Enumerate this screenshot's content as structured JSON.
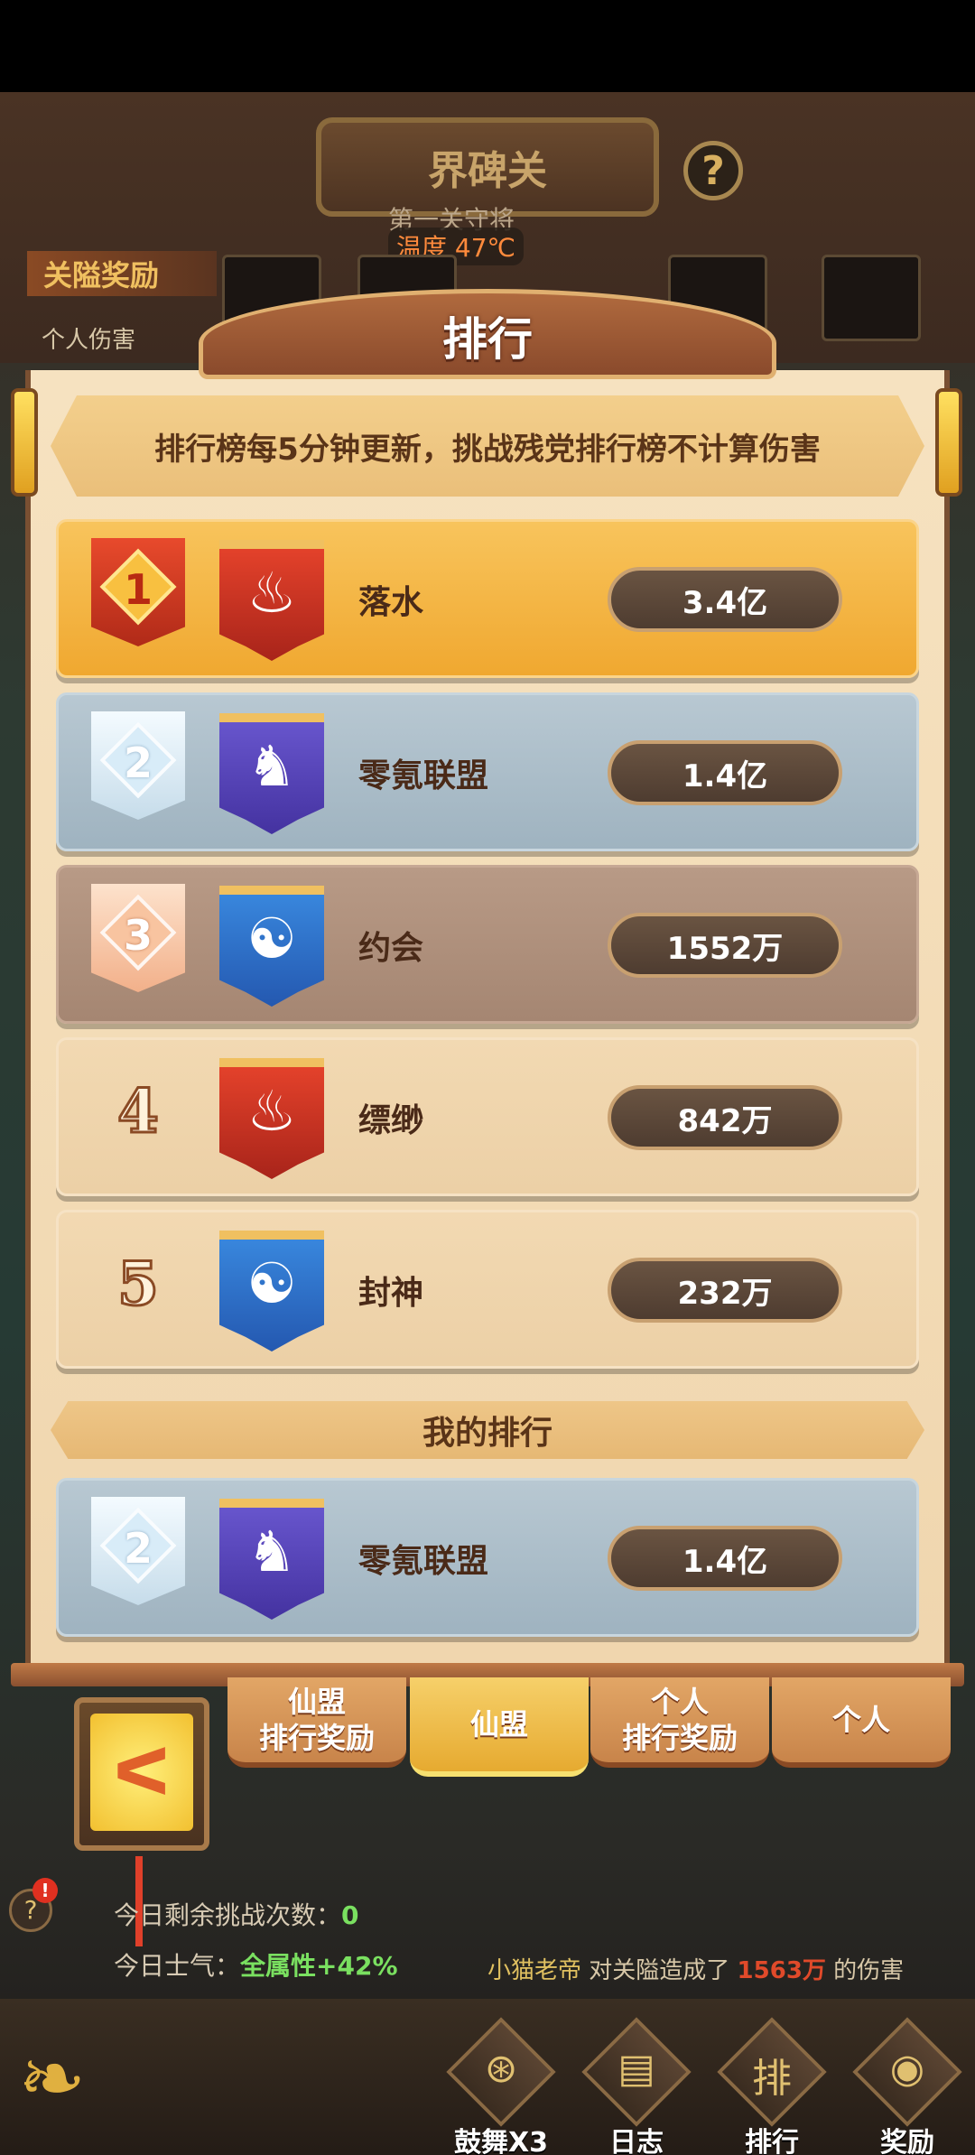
{
  "background": {
    "gate_title": "界碑关",
    "gate_subtitle": "第一关守将",
    "temperature": "温度 47℃",
    "pass_reward_label": "关隘奖励",
    "personal_damage_label": "个人伤害",
    "help_icon": "?"
  },
  "modal": {
    "title": "排行",
    "notice": "排行榜每5分钟更新，挑战残党排行榜不计算伤害",
    "my_rank_header": "我的排行"
  },
  "rankings": [
    {
      "rank": "1",
      "guild": "落水",
      "score": "3.4亿",
      "emblem": "phoenix-icon",
      "emblem_glyph": "♨",
      "color": "#e8442c"
    },
    {
      "rank": "2",
      "guild": "零氪联盟",
      "score": "1.4亿",
      "emblem": "beast-icon",
      "emblem_glyph": "♞",
      "color": "#5a48c0"
    },
    {
      "rank": "3",
      "guild": "约会",
      "score": "1552万",
      "emblem": "swirl-icon",
      "emblem_glyph": "☯",
      "color": "#3a8ae0"
    },
    {
      "rank": "4",
      "guild": "缥缈",
      "score": "842万",
      "emblem": "phoenix-icon",
      "emblem_glyph": "♨",
      "color": "#e8442c"
    },
    {
      "rank": "5",
      "guild": "封神",
      "score": "232万",
      "emblem": "swirl-icon",
      "emblem_glyph": "☯",
      "color": "#3a8ae0"
    }
  ],
  "my_rank": {
    "rank": "2",
    "guild": "零氪联盟",
    "score": "1.4亿",
    "emblem": "beast-icon",
    "emblem_glyph": "♞"
  },
  "tabs": [
    {
      "line1": "仙盟",
      "line2": "排行奖励",
      "active": false
    },
    {
      "line1": "仙盟",
      "line2": "",
      "active": true
    },
    {
      "line1": "个人",
      "line2": "排行奖励",
      "active": false
    },
    {
      "line1": "个人",
      "line2": "",
      "active": false
    }
  ],
  "back_button": {
    "glyph": "ᐸ",
    "icon": "back-arrow-icon"
  },
  "info": {
    "remaining_label": "今日剩余挑战次数：",
    "remaining_value": "0",
    "morale_label": "今日士气：",
    "morale_value": "全属性+42%"
  },
  "ticker": {
    "player": "小猫老帝",
    "text_mid": " 对关隘造成了 ",
    "amount": "1563万",
    "text_end": " 的伤害"
  },
  "bottom_nav": [
    {
      "label": "鼓舞X3",
      "icon": "drum-icon",
      "glyph": "⊛"
    },
    {
      "label": "日志",
      "icon": "log-book-icon",
      "glyph": "▤"
    },
    {
      "label": "排行",
      "icon": "ranking-icon",
      "glyph": "排"
    },
    {
      "label": "奖励",
      "icon": "reward-bag-icon",
      "glyph": "◉"
    }
  ]
}
